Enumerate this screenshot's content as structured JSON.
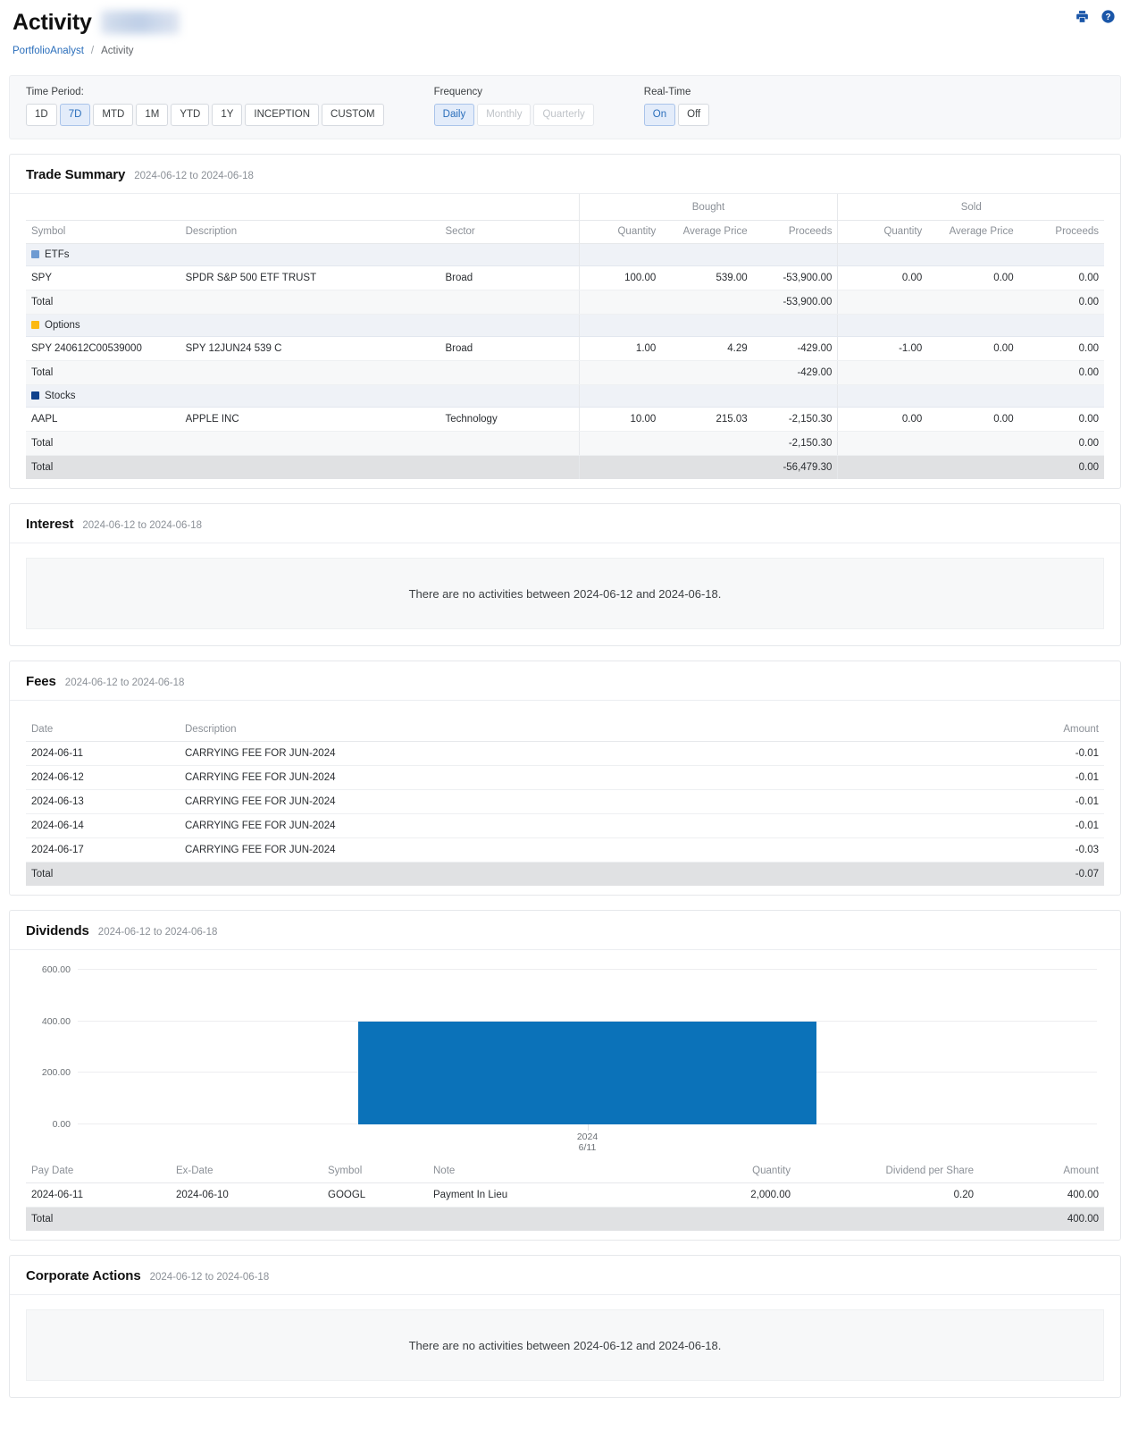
{
  "header": {
    "title": "Activity",
    "account_masked": "",
    "print_icon": "printer-icon",
    "help_icon": "help-icon",
    "breadcrumb": {
      "root": "PortfolioAnalyst",
      "separator": "/",
      "current": "Activity"
    }
  },
  "filters": {
    "time_period": {
      "label": "Time Period:",
      "options": [
        "1D",
        "7D",
        "MTD",
        "1M",
        "YTD",
        "1Y",
        "INCEPTION",
        "CUSTOM"
      ],
      "selected": "7D"
    },
    "frequency": {
      "label": "Frequency",
      "options": [
        "Daily",
        "Monthly",
        "Quarterly"
      ],
      "selected": "Daily",
      "disabled": [
        "Monthly",
        "Quarterly"
      ]
    },
    "realtime": {
      "label": "Real-Time",
      "options": [
        "On",
        "Off"
      ],
      "selected": "On"
    }
  },
  "date_range": "2024-06-12 to 2024-06-18",
  "trade_summary": {
    "title": "Trade Summary",
    "range": "2024-06-12 to 2024-06-18",
    "group_headers": [
      "Bought",
      "Sold"
    ],
    "columns": [
      "Symbol",
      "Description",
      "Sector",
      "Quantity",
      "Average Price",
      "Proceeds",
      "Quantity",
      "Average Price",
      "Proceeds"
    ],
    "groups": [
      {
        "name": "ETFs",
        "color": "#6e9bd2",
        "rows": [
          {
            "symbol": "SPY",
            "description": "SPDR S&P 500 ETF TRUST",
            "sector": "Broad",
            "bought_quantity": "100.00",
            "bought_avg_price": "539.00",
            "bought_proceeds": "-53,900.00",
            "sold_quantity": "0.00",
            "sold_avg_price": "0.00",
            "sold_proceeds": "0.00"
          }
        ],
        "total": {
          "label": "Total",
          "bought_proceeds": "-53,900.00",
          "sold_proceeds": "0.00"
        }
      },
      {
        "name": "Options",
        "color": "#fcb913",
        "rows": [
          {
            "symbol": "SPY 240612C00539000",
            "description": "SPY 12JUN24 539 C",
            "sector": "Broad",
            "bought_quantity": "1.00",
            "bought_avg_price": "4.29",
            "bought_proceeds": "-429.00",
            "sold_quantity": "-1.00",
            "sold_avg_price": "0.00",
            "sold_proceeds": "0.00"
          }
        ],
        "total": {
          "label": "Total",
          "bought_proceeds": "-429.00",
          "sold_proceeds": "0.00"
        }
      },
      {
        "name": "Stocks",
        "color": "#10428c",
        "rows": [
          {
            "symbol": "AAPL",
            "description": "APPLE INC",
            "sector": "Technology",
            "bought_quantity": "10.00",
            "bought_avg_price": "215.03",
            "bought_proceeds": "-2,150.30",
            "sold_quantity": "0.00",
            "sold_avg_price": "0.00",
            "sold_proceeds": "0.00"
          }
        ],
        "total": {
          "label": "Total",
          "bought_proceeds": "-2,150.30",
          "sold_proceeds": "0.00"
        }
      }
    ],
    "grand_total": {
      "label": "Total",
      "bought_proceeds": "-56,479.30",
      "sold_proceeds": "0.00"
    }
  },
  "interest": {
    "title": "Interest",
    "range": "2024-06-12 to 2024-06-18",
    "empty_message": "There are no activities between 2024-06-12 and 2024-06-18."
  },
  "fees": {
    "title": "Fees",
    "range": "2024-06-12 to 2024-06-18",
    "columns": [
      "Date",
      "Description",
      "Amount"
    ],
    "rows": [
      {
        "date": "2024-06-11",
        "description": "CARRYING FEE FOR JUN-2024",
        "amount": "-0.01"
      },
      {
        "date": "2024-06-12",
        "description": "CARRYING FEE FOR JUN-2024",
        "amount": "-0.01"
      },
      {
        "date": "2024-06-13",
        "description": "CARRYING FEE FOR JUN-2024",
        "amount": "-0.01"
      },
      {
        "date": "2024-06-14",
        "description": "CARRYING FEE FOR JUN-2024",
        "amount": "-0.01"
      },
      {
        "date": "2024-06-17",
        "description": "CARRYING FEE FOR JUN-2024",
        "amount": "-0.03"
      }
    ],
    "total": {
      "label": "Total",
      "amount": "-0.07"
    }
  },
  "dividends": {
    "title": "Dividends",
    "range": "2024-06-12 to 2024-06-18",
    "columns": [
      "Pay Date",
      "Ex-Date",
      "Symbol",
      "Note",
      "Quantity",
      "Dividend per Share",
      "Amount"
    ],
    "rows": [
      {
        "pay_date": "2024-06-11",
        "ex_date": "2024-06-10",
        "symbol": "GOOGL",
        "note": "Payment In Lieu",
        "quantity": "2,000.00",
        "dividend_per_share": "0.20",
        "amount": "400.00"
      }
    ],
    "total": {
      "label": "Total",
      "amount": "400.00"
    }
  },
  "corporate_actions": {
    "title": "Corporate Actions",
    "range": "2024-06-12 to 2024-06-18",
    "empty_message": "There are no activities between 2024-06-12 and 2024-06-18."
  },
  "chart_data": {
    "type": "bar",
    "title": "Dividends",
    "categories": [
      "2024\n6/11"
    ],
    "x_tick_labels": [
      {
        "line1": "2024",
        "line2": "6/11"
      }
    ],
    "values": [
      400.0
    ],
    "y_ticks": [
      "0.00",
      "200.00",
      "400.00",
      "600.00"
    ],
    "y_tick_values": [
      0,
      200,
      400,
      600
    ],
    "ylim": [
      0,
      600
    ],
    "xlabel": "",
    "ylabel": "",
    "grid": true,
    "legend": false,
    "series_color": "#0b72b9"
  }
}
